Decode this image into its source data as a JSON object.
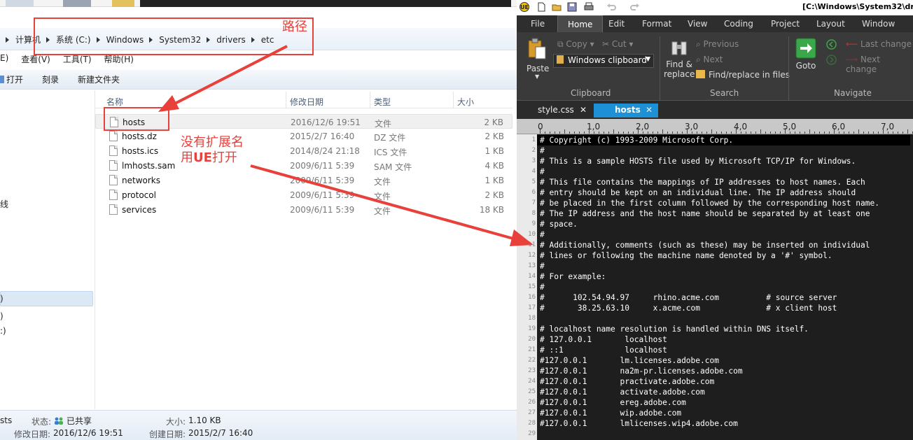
{
  "explorer": {
    "breadcrumb": [
      "计算机",
      "系统 (C:)",
      "Windows",
      "System32",
      "drivers",
      "etc"
    ],
    "menu": [
      "E)",
      "查看(V)",
      "工具(T)",
      "帮助(H)"
    ],
    "commands": [
      "打开",
      "刻录",
      "新建文件夹"
    ],
    "nav_items": [
      ")",
      ")",
      ":)",
      "线"
    ],
    "columns": {
      "name": "名称",
      "date": "修改日期",
      "type": "类型",
      "size": "大小"
    },
    "files": [
      {
        "name": "hosts",
        "date": "2016/12/6 19:51",
        "type": "文件",
        "size": "2 KB"
      },
      {
        "name": "hosts.dz",
        "date": "2015/2/7 16:40",
        "type": "DZ 文件",
        "size": "2 KB"
      },
      {
        "name": "hosts.ics",
        "date": "2014/8/24 21:18",
        "type": "ICS 文件",
        "size": "1 KB"
      },
      {
        "name": "lmhosts.sam",
        "date": "2009/6/11 5:39",
        "type": "SAM 文件",
        "size": "4 KB"
      },
      {
        "name": "networks",
        "date": "2009/6/11 5:39",
        "type": "文件",
        "size": "1 KB"
      },
      {
        "name": "protocol",
        "date": "2009/6/11 5:39",
        "type": "文件",
        "size": "2 KB"
      },
      {
        "name": "services",
        "date": "2009/6/11 5:39",
        "type": "文件",
        "size": "18 KB"
      }
    ],
    "status": {
      "name_partial": "sts",
      "state_label": "状态:",
      "state_value": "已共享",
      "size_label": "大小:",
      "size_value": "1.10 KB",
      "modified_label": "修改日期:",
      "modified_value": "2016/12/6 19:51",
      "created_label": "创建日期:",
      "created_value": "2015/2/7 16:40"
    }
  },
  "annotations": {
    "path_label": "路径",
    "note_line1": "没有扩展名",
    "note_line2_prefix": "用",
    "note_line2_bold": "UE",
    "note_line2_suffix": "打开",
    "color": "#e8403a"
  },
  "ue": {
    "title": "[C:\\Windows\\System32\\drive",
    "ribbon_tabs": [
      "File",
      "Home",
      "Edit",
      "Format",
      "View",
      "Coding",
      "Project",
      "Layout",
      "Window"
    ],
    "active_tab": "Home",
    "clipboard": {
      "paste": "Paste",
      "copy": "Copy",
      "cut": "Cut",
      "windows_clipboard": "Windows clipboard",
      "group": "Clipboard"
    },
    "search": {
      "find_line1": "Find &",
      "find_line2": "replace",
      "previous": "Previous",
      "next": "Next",
      "find_in_files": "Find/replace in files",
      "group": "Search"
    },
    "navigate": {
      "goto": "Goto",
      "last_change": "Last change",
      "next_change": "Next change",
      "group": "Navigate"
    },
    "doc_tabs": [
      {
        "name": "style.css",
        "close": "✕"
      },
      {
        "name": "hosts",
        "close": "✕"
      }
    ],
    "ruler": [
      "0",
      "1,0",
      "2,0",
      "3,0",
      "4,0",
      "5,0",
      "6,0",
      "7,0"
    ],
    "lines": [
      "# Copyright (c) 1993-2009 Microsoft Corp.",
      "#",
      "# This is a sample HOSTS file used by Microsoft TCP/IP for Windows.",
      "#",
      "# This file contains the mappings of IP addresses to host names. Each",
      "# entry should be kept on an individual line. The IP address should",
      "# be placed in the first column followed by the corresponding host name.",
      "# The IP address and the host name should be separated by at least one",
      "# space.",
      "#",
      "# Additionally, comments (such as these) may be inserted on individual",
      "# lines or following the machine name denoted by a '#' symbol.",
      "#",
      "# For example:",
      "#",
      "#      102.54.94.97     rhino.acme.com          # source server",
      "#       38.25.63.10     x.acme.com              # x client host",
      "",
      "# localhost name resolution is handled within DNS itself.",
      "# 127.0.0.1       localhost",
      "# ::1             localhost",
      "#127.0.0.1       lm.licenses.adobe.com",
      "#127.0.0.1       na2m-pr.licenses.adobe.com",
      "#127.0.0.1       practivate.adobe.com",
      "#127.0.0.1       activate.adobe.com",
      "#127.0.0.1       ereg.adobe.com",
      "#127.0.0.1       wip.adobe.com",
      "#127.0.0.1       lmlicenses.wip4.adobe.com",
      ""
    ],
    "line_numbers": [
      "1",
      "2",
      "3",
      "4",
      "5",
      "6",
      "7",
      "8",
      "9",
      "10",
      "11",
      "12",
      "13",
      "14",
      "15",
      "16",
      "17",
      "18",
      "19",
      "20",
      "21",
      "22",
      "23",
      "24",
      "25",
      "26",
      "27",
      "28",
      "29"
    ]
  }
}
